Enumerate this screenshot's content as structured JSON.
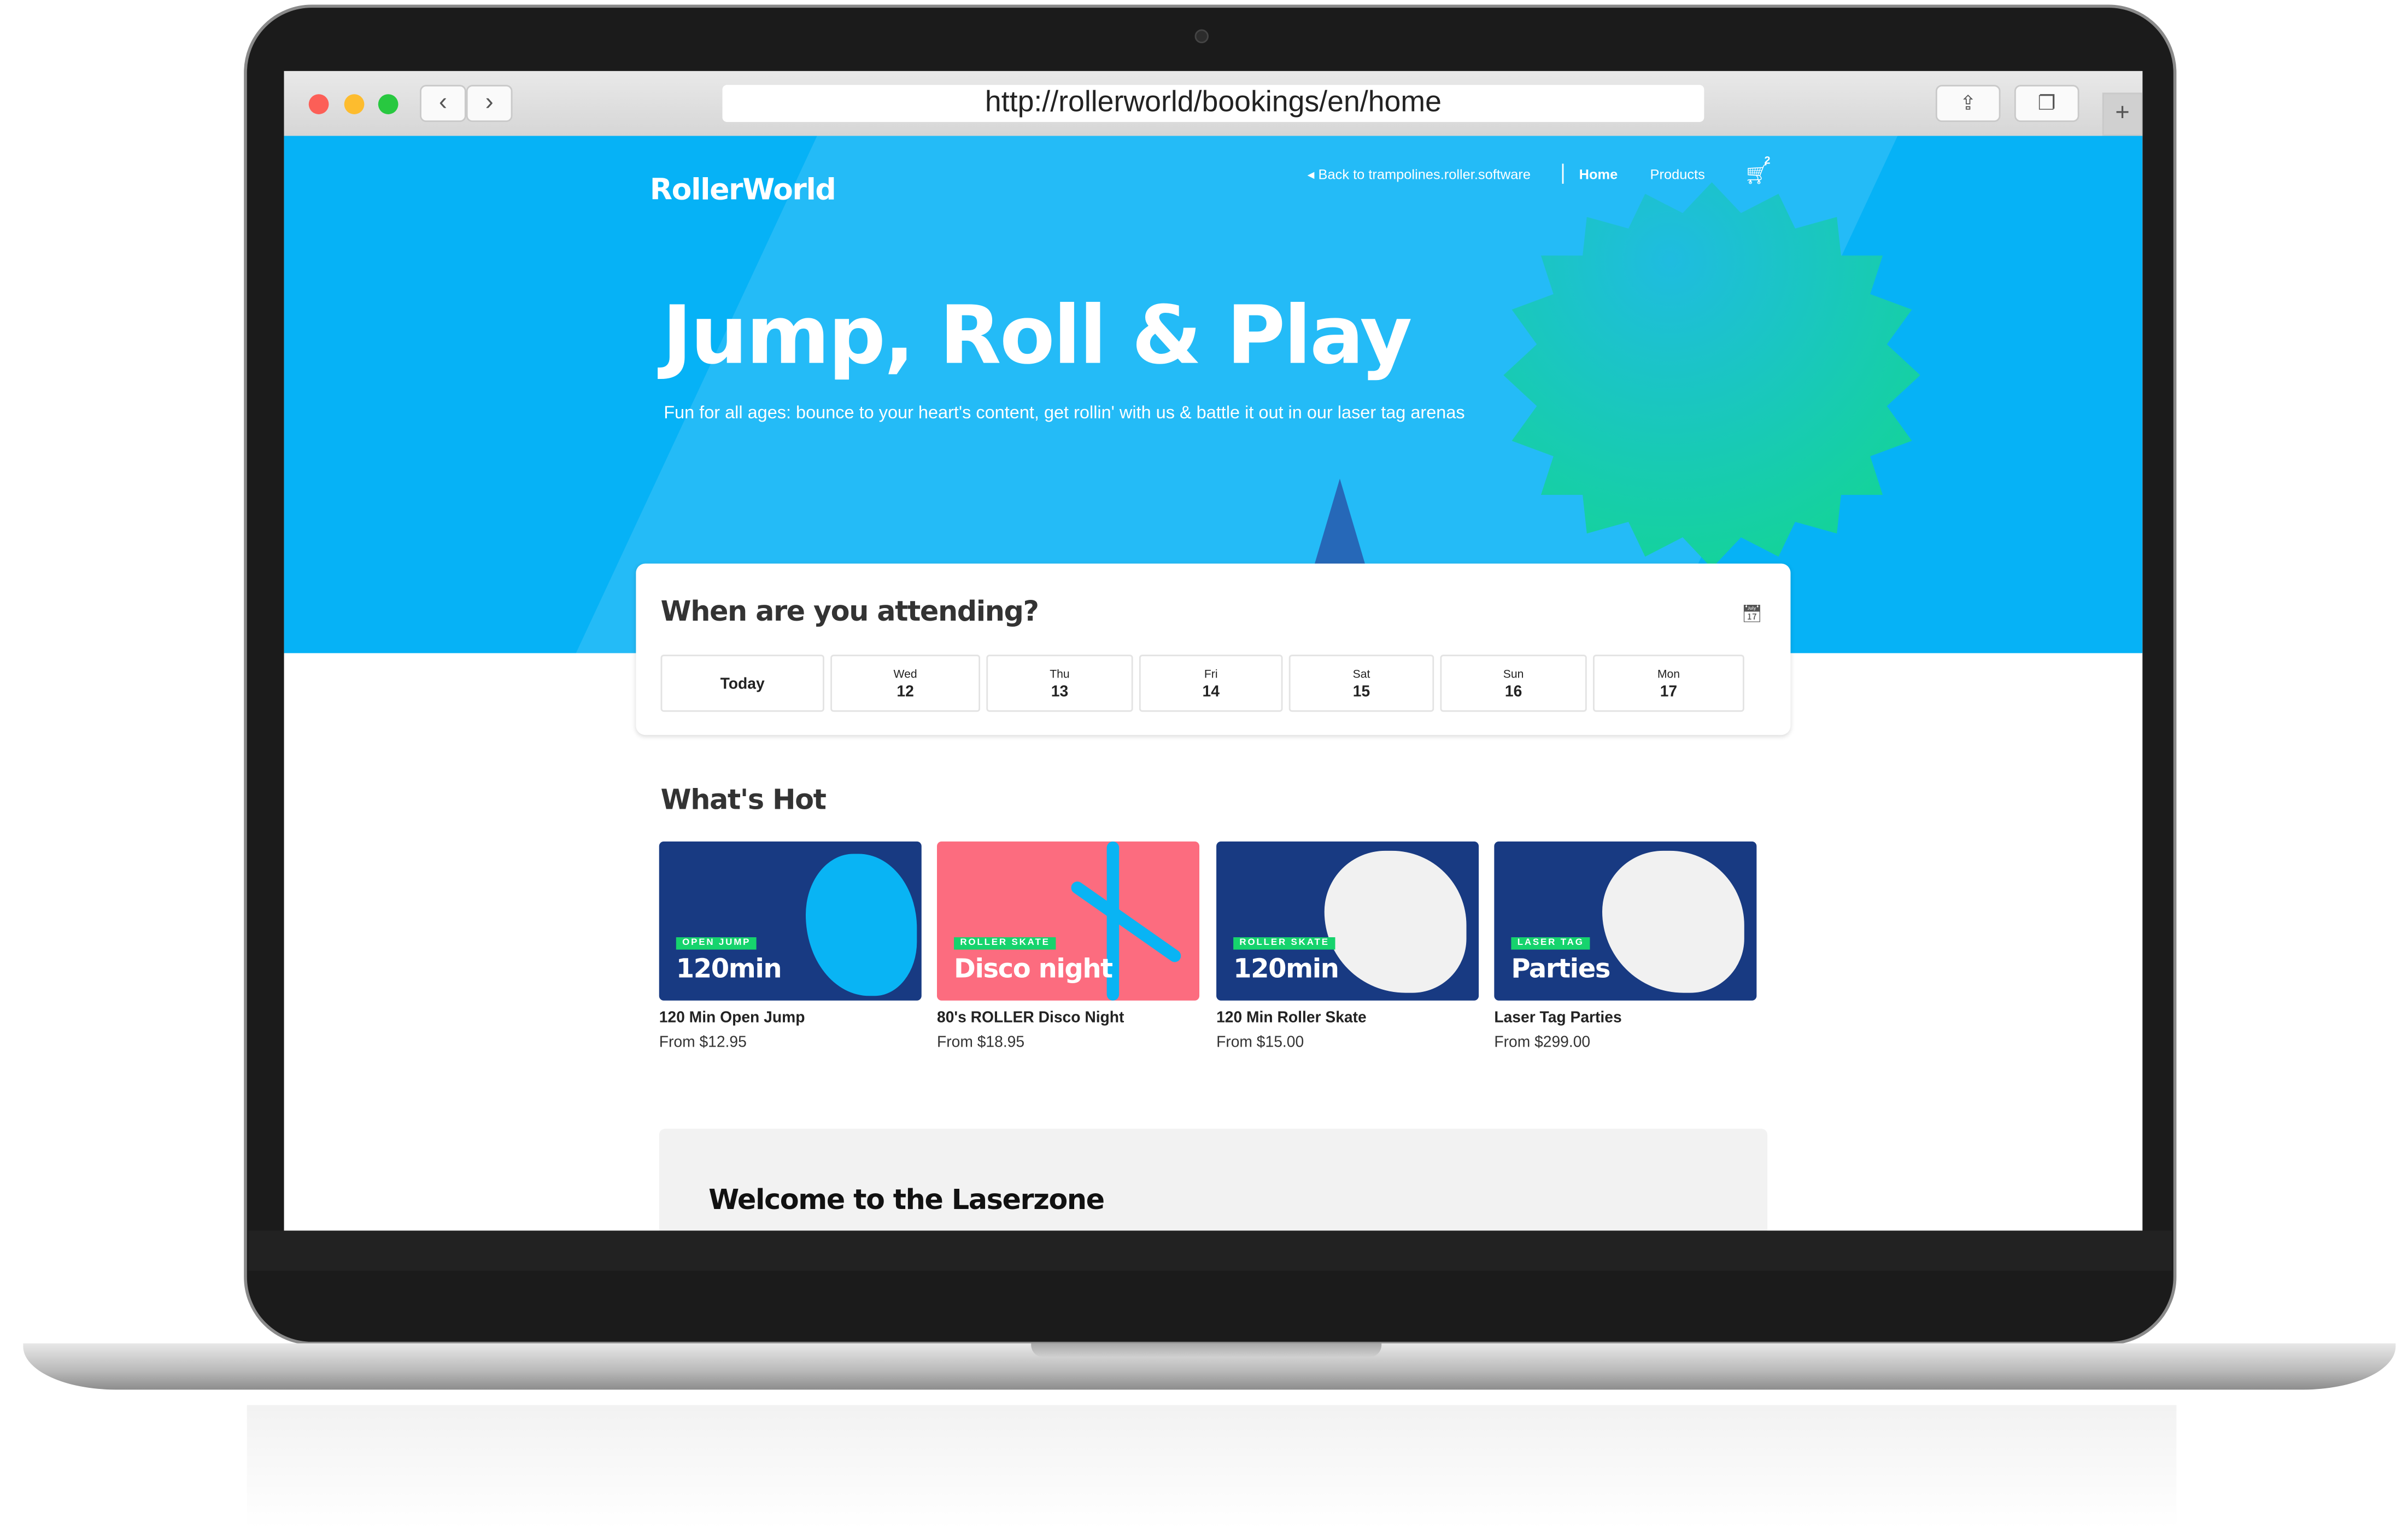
{
  "browser": {
    "url": "http://rollerworld/bookings/en/home",
    "back_icon": "chevron-left-icon",
    "forward_icon": "chevron-right-icon",
    "share_icon": "share-icon",
    "tabs_icon": "tabs-icon",
    "new_tab_icon": "plus-icon"
  },
  "header": {
    "logo": "RollerWorld",
    "back_link": "Back to trampolines.roller.software",
    "nav": [
      "Home",
      "Products"
    ],
    "cart_count": "2",
    "hero_color": "#06b2f6"
  },
  "hero": {
    "title": "Jump, Roll & Play",
    "subtitle": "Fun for all ages: bounce to your heart's content, get rollin' with us & battle it out in our laser tag arenas"
  },
  "date_picker": {
    "title": "When are you attending?",
    "today_label": "Today",
    "dates": [
      {
        "day": "Wed",
        "num": "12"
      },
      {
        "day": "Thu",
        "num": "13"
      },
      {
        "day": "Fri",
        "num": "14"
      },
      {
        "day": "Sat",
        "num": "15"
      },
      {
        "day": "Sun",
        "num": "16"
      },
      {
        "day": "Mon",
        "num": "17"
      }
    ]
  },
  "whats_hot": {
    "title": "What's Hot",
    "items": [
      {
        "tag": "OPEN JUMP",
        "headline": "120min",
        "name": "120 Min Open Jump",
        "price": "From $12.95"
      },
      {
        "tag": "ROLLER SKATE",
        "headline": "Disco night",
        "name": "80's ROLLER Disco Night",
        "price": "From $18.95"
      },
      {
        "tag": "ROLLER SKATE",
        "headline": "120min",
        "name": "120 Min Roller Skate",
        "price": "From $15.00"
      },
      {
        "tag": "LASER TAG",
        "headline": "Parties",
        "name": "Laser Tag Parties",
        "price": "From $299.00"
      }
    ]
  },
  "welcome": {
    "title": "Welcome to the Laserzone"
  }
}
